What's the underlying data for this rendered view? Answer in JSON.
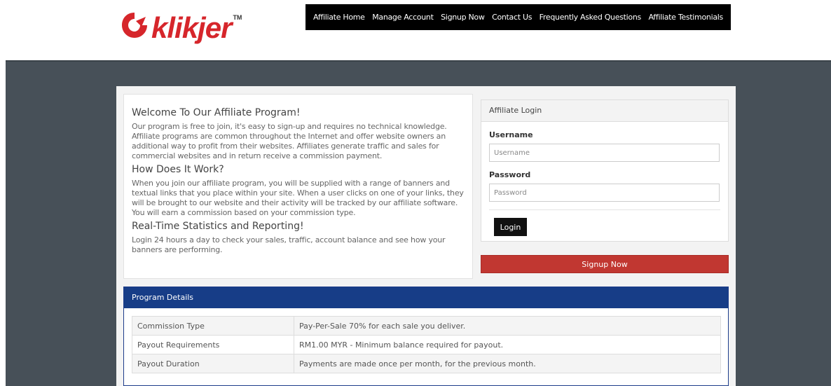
{
  "brand": {
    "name": "klikjer",
    "tm": "TM"
  },
  "nav": [
    "Affiliate Home",
    "Manage Account",
    "Signup Now",
    "Contact Us",
    "Frequently Asked Questions",
    "Affiliate Testimonials"
  ],
  "welcome": {
    "title": "Welcome To Our Affiliate Program!",
    "intro": "Our program is free to join, it's easy to sign-up and requires no technical knowledge. Affiliate programs are common throughout the Internet and offer website owners an additional way to profit from their websites. Affiliates generate traffic and sales for commercial websites and in return receive a commission payment.",
    "how_title": "How Does It Work?",
    "how_text": "When you join our affiliate program, you will be supplied with a range of banners and textual links that you place within your site. When a user clicks on one of your links, they will be brought to our website and their activity will be tracked by our affiliate software. You will earn a commission based on your commission type.",
    "stats_title": "Real-Time Statistics and Reporting!",
    "stats_text": "Login 24 hours a day to check your sales, traffic, account balance and see how your banners are performing."
  },
  "login": {
    "heading": "Affiliate Login",
    "username_label": "Username",
    "username_placeholder": "Username",
    "password_label": "Password",
    "password_placeholder": "Password",
    "button": "Login"
  },
  "signup_button": "Signup Now",
  "program": {
    "heading": "Program Details",
    "rows": [
      {
        "key": "Commission Type",
        "value": "Pay-Per-Sale 70% for each sale you deliver."
      },
      {
        "key": "Payout Requirements",
        "value": "RM1.00 MYR - Minimum balance required for payout."
      },
      {
        "key": "Payout Duration",
        "value": "Payments are made once per month, for the previous month."
      }
    ]
  },
  "colors": {
    "brand_red": "#d6262b",
    "band": "#475058",
    "program_header": "#173d87",
    "signup": "#c13731"
  }
}
